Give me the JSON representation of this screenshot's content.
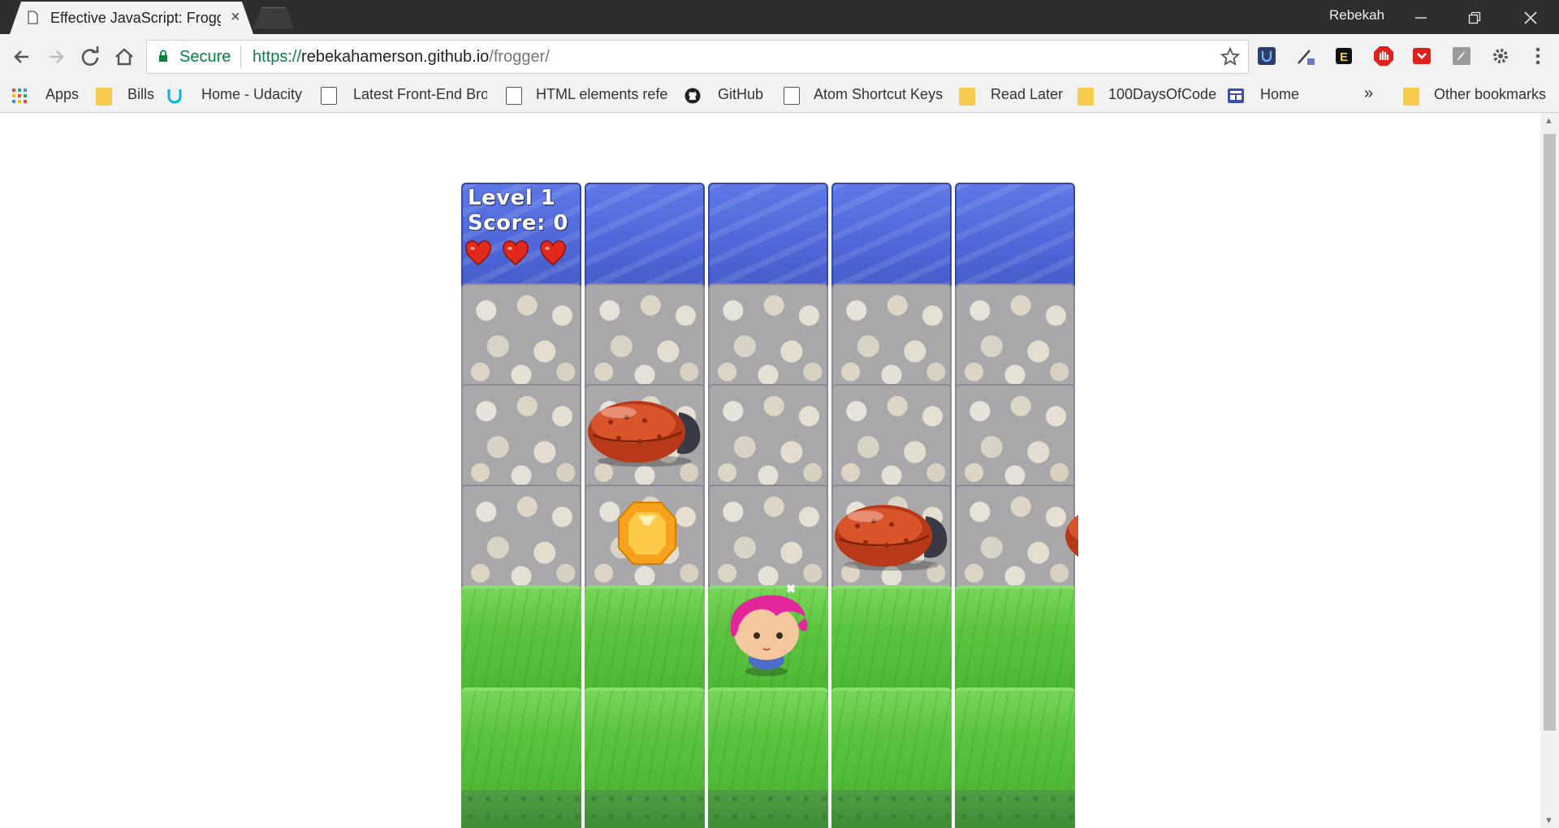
{
  "browser": {
    "tab": {
      "title": "Effective JavaScript: Frogger",
      "close": "×"
    },
    "profile": "Rebekah",
    "window_controls": {
      "minimize": "—",
      "restore": "❐",
      "close": "✕"
    },
    "omnibox": {
      "secure_label": "Secure",
      "url_scheme": "https://",
      "url_host": "rebekahamerson.github.io",
      "url_path": "/frogger/"
    },
    "accent_secure": "#0b8043"
  },
  "bookmarks": {
    "items": [
      {
        "label": "Apps",
        "icon": "apps-grid-icon"
      },
      {
        "label": "Bills",
        "icon": "folder-icon"
      },
      {
        "label": "Home - Udacity",
        "icon": "udacity-icon"
      },
      {
        "label": "Latest Front-End Bro",
        "icon": "page-icon"
      },
      {
        "label": "HTML elements refe",
        "icon": "page-icon"
      },
      {
        "label": "GitHub",
        "icon": "github-icon"
      },
      {
        "label": "Atom Shortcut Keys",
        "icon": "page-icon"
      },
      {
        "label": "Read Later",
        "icon": "folder-icon"
      },
      {
        "label": "100DaysOfCode",
        "icon": "folder-icon"
      },
      {
        "label": "Home",
        "icon": "trello-icon"
      }
    ],
    "more": "»",
    "other": "Other bookmarks"
  },
  "game": {
    "level_text": "Level 1",
    "score_text": "Score: 0",
    "lives": 3,
    "rows": [
      "water",
      "stone",
      "stone",
      "stone",
      "grass",
      "grass"
    ],
    "columns": 5,
    "colors": {
      "water": "#5069d8",
      "grass": "#5cc43f",
      "stone": "#e4ded1",
      "heart": "#e0281c"
    }
  }
}
